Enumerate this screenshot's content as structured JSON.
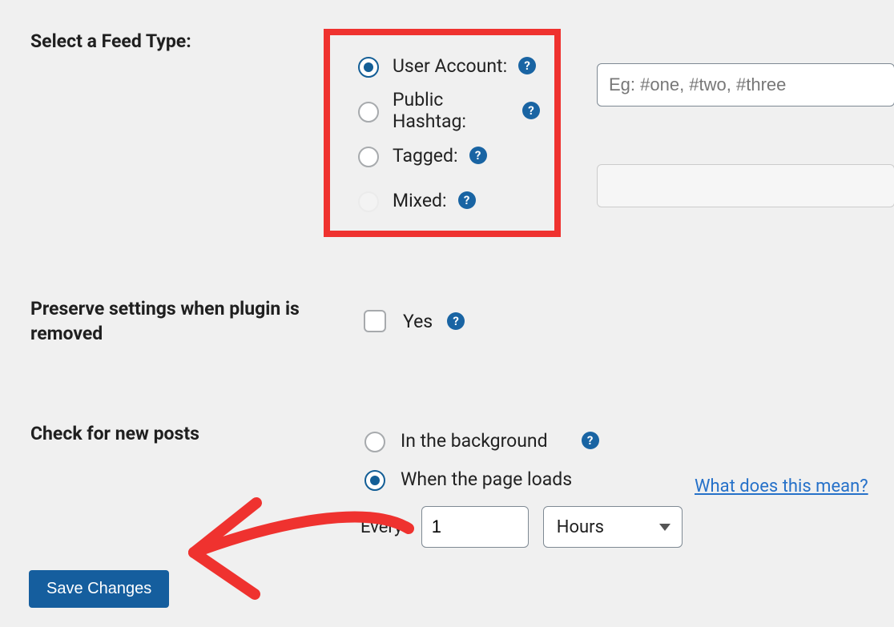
{
  "feedType": {
    "label": "Select a Feed Type:",
    "options": {
      "user": {
        "label": "User Account:"
      },
      "hashtag": {
        "label": "Public Hashtag:",
        "placeholder": "Eg: #one, #two, #three"
      },
      "tagged": {
        "label": "Tagged:"
      },
      "mixed": {
        "label": "Mixed:"
      }
    },
    "selected": "user"
  },
  "preserve": {
    "label": "Preserve settings when plugin is removed",
    "checkbox_label": "Yes",
    "checked": false
  },
  "checkPosts": {
    "label": "Check for new posts",
    "options": {
      "background": {
        "label": "In the background"
      },
      "onload": {
        "label": "When the page loads"
      }
    },
    "selected": "onload",
    "interval": {
      "prefix": "Every:",
      "value": "1",
      "unit": "Hours"
    },
    "learn_more": "What does this mean?"
  },
  "save_button": "Save Changes",
  "annotations": {
    "highlight_box_color": "#ef322f",
    "arrow_color": "#ef322f"
  }
}
